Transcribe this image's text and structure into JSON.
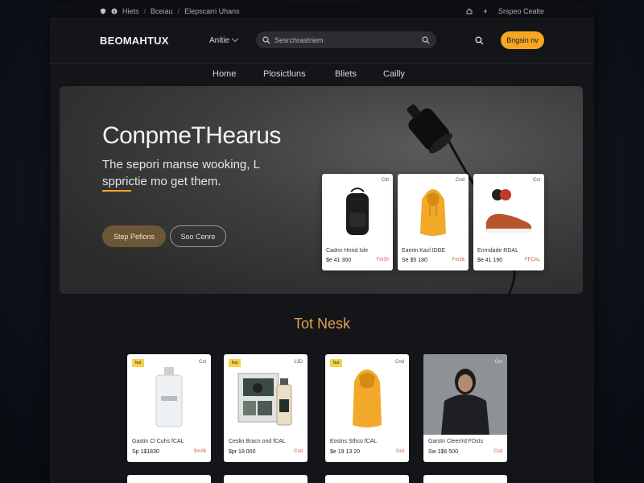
{
  "topbar": {
    "crumbs": [
      "Hiets",
      "Bceiau",
      "Elepscarri Uhans"
    ],
    "right_label": "Srspeo Cealte"
  },
  "header": {
    "logo_main": "BEOMAHTUX",
    "author_label": "Anitie",
    "search_placeholder": "Sesrchrastriem",
    "signup_label": "Bngsin nv"
  },
  "nav": {
    "items": [
      "Home",
      "Plosictluns",
      "Bliets",
      "Cailly"
    ]
  },
  "hero": {
    "title": "ConpmeTHearus",
    "subtitle": "The sepori manse wooking, L spprictie mo get them.",
    "primary_button": "Step Pefions",
    "secondary_button": "Soo Cenre",
    "cards": [
      {
        "name": "Cadnn Hnnd Isle",
        "price": "$e 41 300",
        "old": "Fm30",
        "tag": "Ctit",
        "icon": "backpack-icon"
      },
      {
        "name": "Eamtn Kacl IDBE",
        "price": "Se $5 180",
        "old": "Fm36",
        "tag": "Cnd",
        "icon": "hoodie-icon"
      },
      {
        "name": "Enrndade RDAL",
        "price": "$e 41 190",
        "old": "FFCAL",
        "tag": "Cct",
        "icon": "sneaker-icon"
      }
    ]
  },
  "section": {
    "title": "Tot Nesk"
  },
  "products": [
    {
      "name": "Gastin Cl Cuhs fCAL",
      "price": "Sp 1$1830",
      "old": "Sm36",
      "badge": "Nat",
      "tag": "Cst",
      "icon": "perfume-bottle-icon"
    },
    {
      "name": "Ceslin Bracn ond fCAL",
      "price": "$pr 18 000",
      "old": "Cnd",
      "badge": "Nat",
      "tag": "13D",
      "icon": "gift-set-icon"
    },
    {
      "name": "Eoslns Sthco fCAL",
      "price": "$e 19 13 20",
      "old": "Grd",
      "badge": "Nat",
      "tag": "Cnd",
      "icon": "hoodie-icon"
    },
    {
      "name": "Garstn Cleer/rd FDsts",
      "price": "Sw 1$6 500",
      "old": "Ccd",
      "badge": "",
      "tag": "Crrl",
      "icon": "jacket-model-icon"
    }
  ],
  "colors": {
    "accent": "#f5a623",
    "background": "#141519",
    "price_old": "#c65b3d"
  }
}
